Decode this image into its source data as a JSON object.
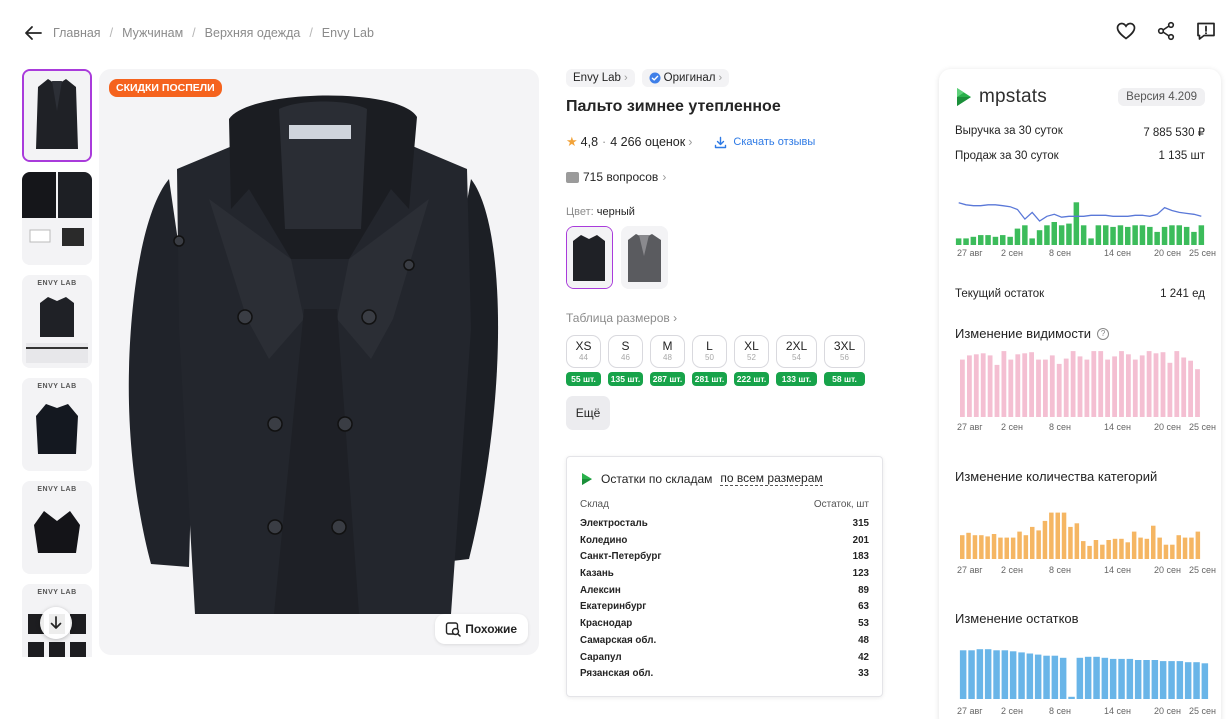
{
  "breadcrumbs": [
    "Главная",
    "Мужчинам",
    "Верхняя одежда",
    "Envy Lab"
  ],
  "thumbnails": [
    {
      "label": ""
    },
    {
      "label": ""
    },
    {
      "label": "ENVY LAB"
    },
    {
      "label": "ENVY LAB"
    },
    {
      "label": "ENVY LAB"
    },
    {
      "label": "ENVY LAB"
    }
  ],
  "product": {
    "sale_badge": "СКИДКИ ПОСПЕЛИ",
    "similar_label": "Похожие",
    "brand": "Envy Lab",
    "original": "Оригинал",
    "title": "Пальто зимнее утепленное",
    "rating": "4,8",
    "reviews": "4 266 оценок",
    "download_reviews": "Скачать отзывы",
    "questions": "715 вопросов",
    "color_label": "Цвет:",
    "color_value": "черный",
    "sizes_label": "Таблица размеров",
    "more_label": "Ещё",
    "sizes": [
      {
        "name": "XS",
        "ru": "44",
        "stock": "55 шт."
      },
      {
        "name": "S",
        "ru": "46",
        "stock": "135 шт."
      },
      {
        "name": "M",
        "ru": "48",
        "stock": "287 шт."
      },
      {
        "name": "L",
        "ru": "50",
        "stock": "281 шт."
      },
      {
        "name": "XL",
        "ru": "52",
        "stock": "222 шт."
      },
      {
        "name": "2XL",
        "ru": "54",
        "stock": "133 шт."
      },
      {
        "name": "3XL",
        "ru": "56",
        "stock": "58 шт."
      }
    ]
  },
  "warehouses": {
    "title": "Остатки по складам",
    "filter": "по всем размерам",
    "col_warehouse": "Склад",
    "col_stock": "Остаток, шт",
    "rows": [
      {
        "name": "Электросталь",
        "qty": "315"
      },
      {
        "name": "Коледино",
        "qty": "201"
      },
      {
        "name": "Санкт-Петербург",
        "qty": "183"
      },
      {
        "name": "Казань",
        "qty": "123"
      },
      {
        "name": "Алексин",
        "qty": "89"
      },
      {
        "name": "Екатеринбург",
        "qty": "63"
      },
      {
        "name": "Краснодар",
        "qty": "53"
      },
      {
        "name": "Самарская обл.",
        "qty": "48"
      },
      {
        "name": "Сарапул",
        "qty": "42"
      },
      {
        "name": "Рязанская обл.",
        "qty": "33"
      }
    ]
  },
  "mpstats": {
    "logo": "mpstats",
    "version": "Версия 4.209",
    "revenue_label": "Выручка за 30 суток",
    "revenue_value": "7 885 530 ₽",
    "sales_label": "Продаж за 30 суток",
    "sales_value": "1 135 шт",
    "current_stock_label": "Текущий остаток",
    "current_stock_value": "1 241 ед",
    "visibility_title": "Изменение видимости",
    "categories_title": "Изменение количества категорий",
    "stock_title": "Изменение остатков",
    "axis_labels": [
      "27 авг",
      "2 сен",
      "8 сен",
      "14 сен",
      "20 сен",
      "25 сен"
    ]
  },
  "colors": {
    "accent": "#a93bdb",
    "sale": "#f5631e",
    "stock_green": "#17a34a",
    "link": "#2e7ae5",
    "sales_bars": "#3cbc5b",
    "price_line": "#5a78d8",
    "visibility_bars": "#f4bfd2",
    "categories_bars": "#f5b663",
    "stock_bars": "#69b5e8"
  },
  "chart_data": [
    {
      "type": "bar",
      "title": "",
      "series": [
        {
          "values": [
            4,
            4,
            5,
            6,
            6,
            5,
            6,
            5,
            10,
            12,
            4,
            9,
            12,
            14,
            12,
            13,
            26,
            12,
            4,
            12,
            12,
            11,
            12,
            11,
            12,
            12,
            11,
            8,
            11,
            12,
            12,
            11,
            8,
            12
          ]
        },
        {
          "values": [
            44,
            42,
            41,
            41,
            42,
            42,
            41,
            40,
            37,
            27,
            34,
            25,
            30,
            32,
            29,
            30,
            30,
            30,
            31,
            31,
            31,
            30,
            30,
            30,
            31,
            31,
            30,
            32,
            39,
            36,
            34,
            33,
            32,
            30
          ]
        }
      ],
      "x_ticks": [
        "27 авг",
        "2 сен",
        "8 сен",
        "14 сен",
        "20 сен",
        "25 сен"
      ]
    },
    {
      "type": "bar",
      "title": "Изменение видимости",
      "series": [
        {
          "values": [
            54,
            58,
            59,
            60,
            58,
            49,
            62,
            54,
            59,
            60,
            61,
            54,
            54,
            58,
            50,
            55,
            62,
            57,
            54,
            62,
            62,
            54,
            57,
            62,
            59,
            54,
            58,
            62,
            60,
            61,
            51,
            62,
            56,
            53,
            45
          ]
        }
      ],
      "x_ticks": [
        "27 авг",
        "2 сен",
        "8 сен",
        "14 сен",
        "20 сен",
        "25 сен"
      ]
    },
    {
      "type": "bar",
      "title": "Изменение количества категорий",
      "series": [
        {
          "values": [
            20,
            22,
            20,
            20,
            19,
            21,
            18,
            18,
            18,
            23,
            20,
            27,
            24,
            32,
            39,
            39,
            39,
            27,
            30,
            15,
            11,
            16,
            12,
            16,
            17,
            17,
            14,
            23,
            18,
            17,
            28,
            18,
            12,
            12,
            20,
            18,
            18,
            23
          ]
        }
      ],
      "x_ticks": [
        "27 авг",
        "2 сен",
        "8 сен",
        "14 сен",
        "20 сен",
        "25 сен"
      ]
    },
    {
      "type": "bar",
      "title": "Изменение остатков",
      "series": [
        {
          "values": [
            45,
            45,
            46,
            46,
            45,
            45,
            44,
            43,
            42,
            41,
            40,
            40,
            38,
            2,
            38,
            39,
            39,
            38,
            37,
            37,
            37,
            36,
            36,
            36,
            35,
            35,
            35,
            34,
            34,
            33
          ]
        }
      ],
      "x_ticks": [
        "27 авг",
        "2 сен",
        "8 сен",
        "14 сен",
        "20 сен",
        "25 сен"
      ]
    }
  ]
}
